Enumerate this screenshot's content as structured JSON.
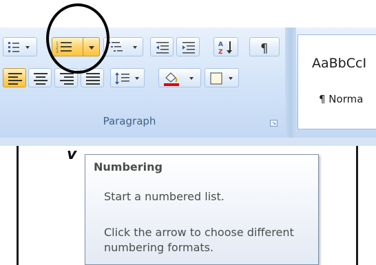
{
  "ribbon": {
    "group_label": "Paragraph",
    "styles": {
      "sample": "AaBbCcI",
      "name": "¶ Norma"
    }
  },
  "buttons": {
    "bullets": "bullets-icon",
    "numbering": "numbering-icon",
    "numbering_dropdown": "chevron-down-icon",
    "multilevel": "multilevel-list-icon",
    "decrease_indent": "decrease-indent-icon",
    "increase_indent": "increase-indent-icon",
    "sort": "sort-az-icon",
    "show_hide": "pilcrow-icon",
    "align_left": "align-left-icon",
    "center": "align-center-icon",
    "align_right": "align-right-icon",
    "justify": "justify-icon",
    "line_spacing": "line-spacing-icon",
    "shading": "paint-bucket-icon",
    "borders": "border-icon"
  },
  "colors": {
    "accent_active": "#ffc43b",
    "shading_red": "#e00000",
    "ribbon_blue": "#d2e3f8"
  },
  "tooltip": {
    "title": "Numbering",
    "line1": "Start a numbered list.",
    "line2": "Click the arrow to choose different numbering formats."
  }
}
